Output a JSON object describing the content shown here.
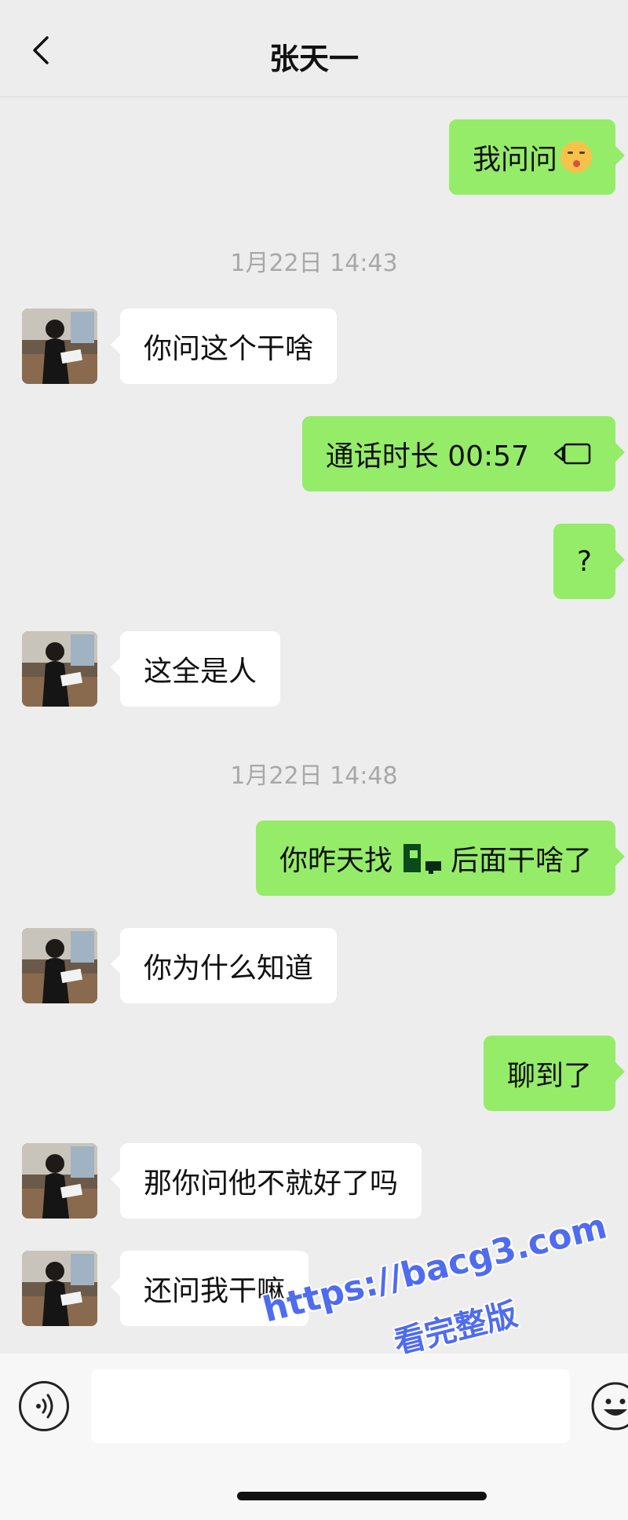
{
  "header": {
    "title": "张天一"
  },
  "messages": [
    {
      "side": "out",
      "text": "我问问",
      "emoji": "face-blowing-kiss-emoji"
    },
    {
      "type": "time",
      "text": "1月22日 14:43"
    },
    {
      "side": "in",
      "text": "你问这个干啥"
    },
    {
      "side": "out",
      "text": "通话时长 00:57",
      "icon": "video-call-icon"
    },
    {
      "side": "out",
      "text": "?"
    },
    {
      "side": "in",
      "text": "这全是人"
    },
    {
      "type": "time",
      "text": "1月22日 14:48"
    },
    {
      "side": "out",
      "text_before": "你昨天找",
      "text_after": "后面干啥了"
    },
    {
      "side": "in",
      "text": "你为什么知道"
    },
    {
      "side": "out",
      "text": "聊到了"
    },
    {
      "side": "in",
      "text": "那你问他不就好了吗"
    },
    {
      "side": "in",
      "text": "还问我干嘛"
    }
  ],
  "input_bar": {
    "value": ""
  },
  "watermark": {
    "line1": "https://bacg3.com",
    "line2": "看完整版"
  },
  "colors": {
    "out_bubble": "#95ec69",
    "in_bubble": "#ffffff",
    "background": "#ededed",
    "watermark": "#4f6cf0"
  }
}
